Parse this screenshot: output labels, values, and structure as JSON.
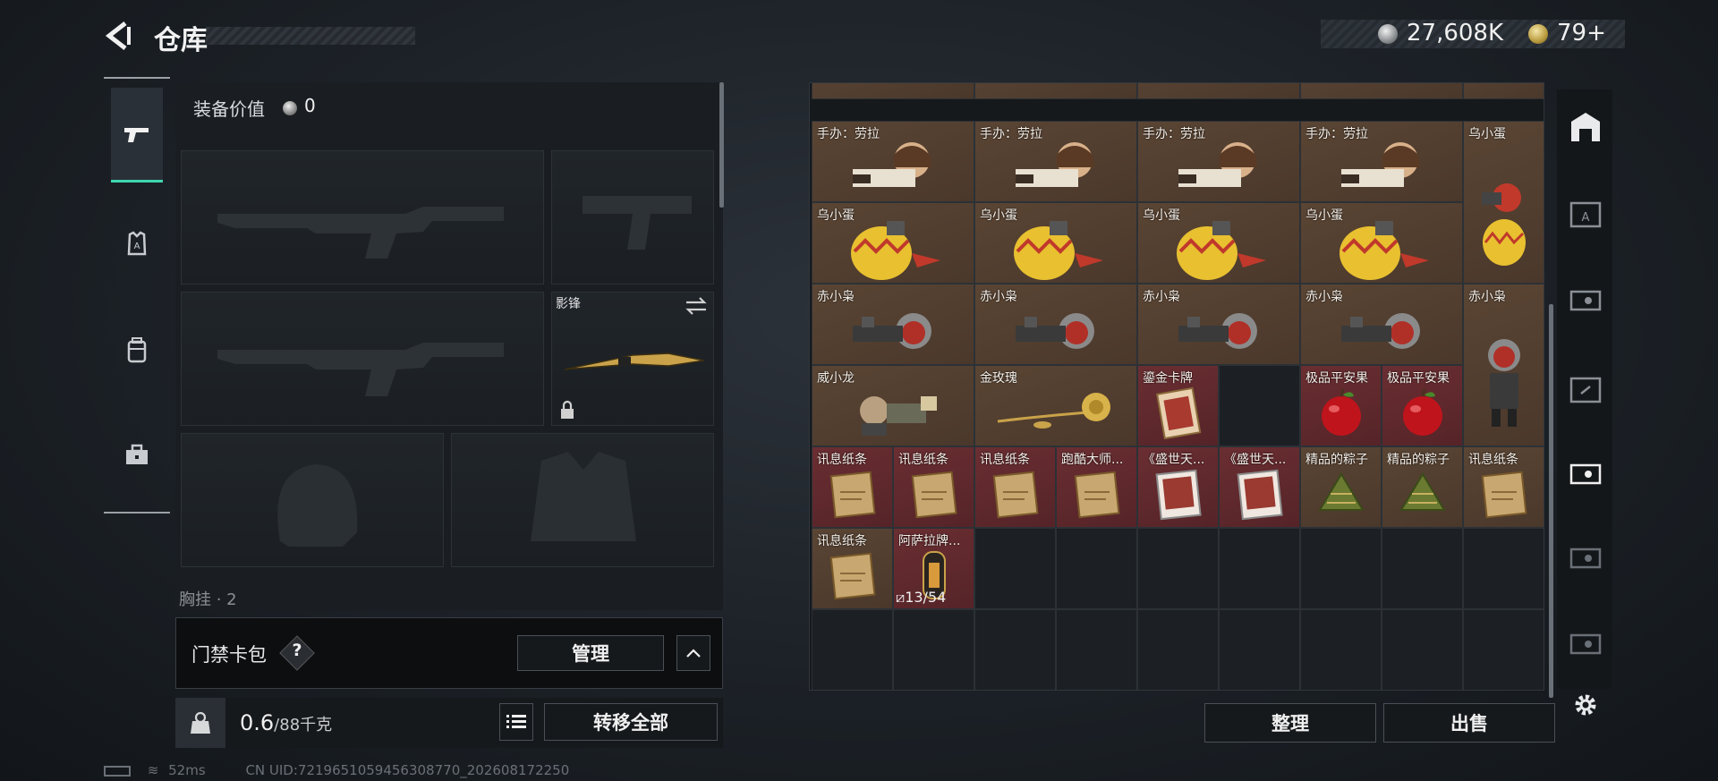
{
  "header": {
    "title": "仓库",
    "currency1": "27,608K",
    "currency2": "79+"
  },
  "equip": {
    "label": "装备价值",
    "value": "0"
  },
  "slots": {
    "melee_name": "影锋",
    "chest_label": "胸挂 · 2"
  },
  "card_pack": {
    "label": "门禁卡包",
    "help": "?",
    "manage": "管理"
  },
  "bottom": {
    "weight": "0.6",
    "weight_unit": "/88千克",
    "transfer_all": "转移全部"
  },
  "status": {
    "ping": "52ms",
    "uid": "CN UID:7219651059456308770_202608172250"
  },
  "grid": {
    "row1": [
      "手办：劳拉",
      "手办：劳拉",
      "手办：劳拉",
      "手办：劳拉",
      "乌小蛋"
    ],
    "row2": [
      "乌小蛋",
      "乌小蛋",
      "乌小蛋",
      "乌小蛋"
    ],
    "row3": [
      "赤小枭",
      "赤小枭",
      "赤小枭",
      "赤小枭",
      "赤小枭"
    ],
    "row4": [
      "威小龙",
      "金玫瑰",
      "鎏金卡牌",
      "极品平安果",
      "极品平安果"
    ],
    "row5": [
      "讯息纸条",
      "讯息纸条",
      "讯息纸条",
      "跑酷大师...",
      "《盛世天...",
      "《盛世天...",
      "精品的粽子",
      "精品的粽子",
      "讯息纸条"
    ],
    "row6": [
      "讯息纸条",
      "阿萨拉牌..."
    ],
    "count": "13/54"
  },
  "actions": {
    "sort": "整理",
    "sell": "出售"
  },
  "icons": [
    "back-arrow-icon",
    "pistol-icon",
    "armor-icon",
    "backpack-icon",
    "toolbox-icon",
    "gear-icon"
  ]
}
